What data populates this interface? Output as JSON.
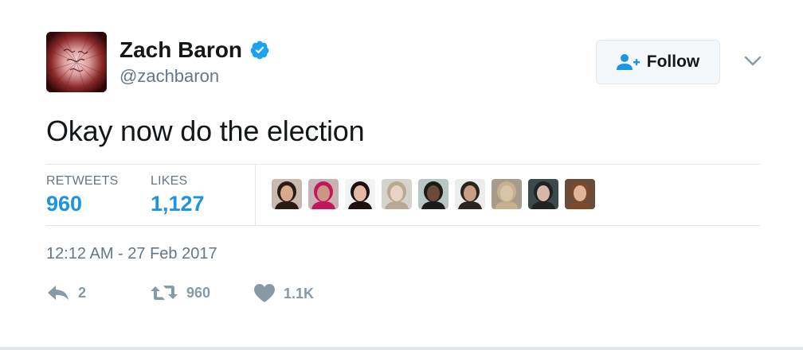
{
  "user": {
    "display_name": "Zach Baron",
    "handle": "@zachbaron",
    "verified": true,
    "avatar_icon": "handwritten-card-avatar"
  },
  "follow_button": {
    "label": "Follow",
    "icon": "add-user-icon"
  },
  "menu": {
    "icon": "chevron-down-icon"
  },
  "tweet": {
    "text": "Okay now do the election"
  },
  "stats": {
    "retweets_label": "RETWEETS",
    "retweets_value": "960",
    "likes_label": "LIKES",
    "likes_value": "1,127"
  },
  "likers": [
    {
      "name": "liker-1",
      "bg": "#c9b9b1",
      "skin": "#d9a98f",
      "hair": "#2a1b15"
    },
    {
      "name": "liker-2",
      "bg": "#c8b4b4",
      "skin": "#c99783",
      "hair": "#c2185b"
    },
    {
      "name": "liker-3",
      "bg": "#f2f2f2",
      "skin": "#e4b9a3",
      "hair": "#1c1010"
    },
    {
      "name": "liker-4",
      "bg": "#d6d2cc",
      "skin": "#e8d3c5",
      "hair": "#b8a990"
    },
    {
      "name": "liker-5",
      "bg": "#b8c7c2",
      "skin": "#6b4a3a",
      "hair": "#1b1b1b"
    },
    {
      "name": "liker-6",
      "bg": "#ececec",
      "skin": "#c89f86",
      "hair": "#2b2520"
    },
    {
      "name": "liker-7",
      "bg": "#a99b8a",
      "skin": "#d9c4a8",
      "hair": "#c7b08f"
    },
    {
      "name": "liker-8",
      "bg": "#3a4a4a",
      "skin": "#d7b8a8",
      "hair": "#222222"
    },
    {
      "name": "liker-9",
      "bg": "#6a4a3a",
      "skin": "#e2b49a",
      "hair": "#7a4a2a"
    }
  ],
  "timestamp": "12:12 AM - 27 Feb 2017",
  "actions": {
    "reply_icon": "reply-icon",
    "reply_count": "2",
    "retweet_icon": "retweet-icon",
    "retweet_count": "960",
    "like_icon": "heart-icon",
    "like_count": "1.1K"
  },
  "colors": {
    "accent": "#1b95e0",
    "verified": "#1da1f2",
    "muted": "#657786",
    "action": "#8899a6",
    "border": "#e1e8ed"
  }
}
